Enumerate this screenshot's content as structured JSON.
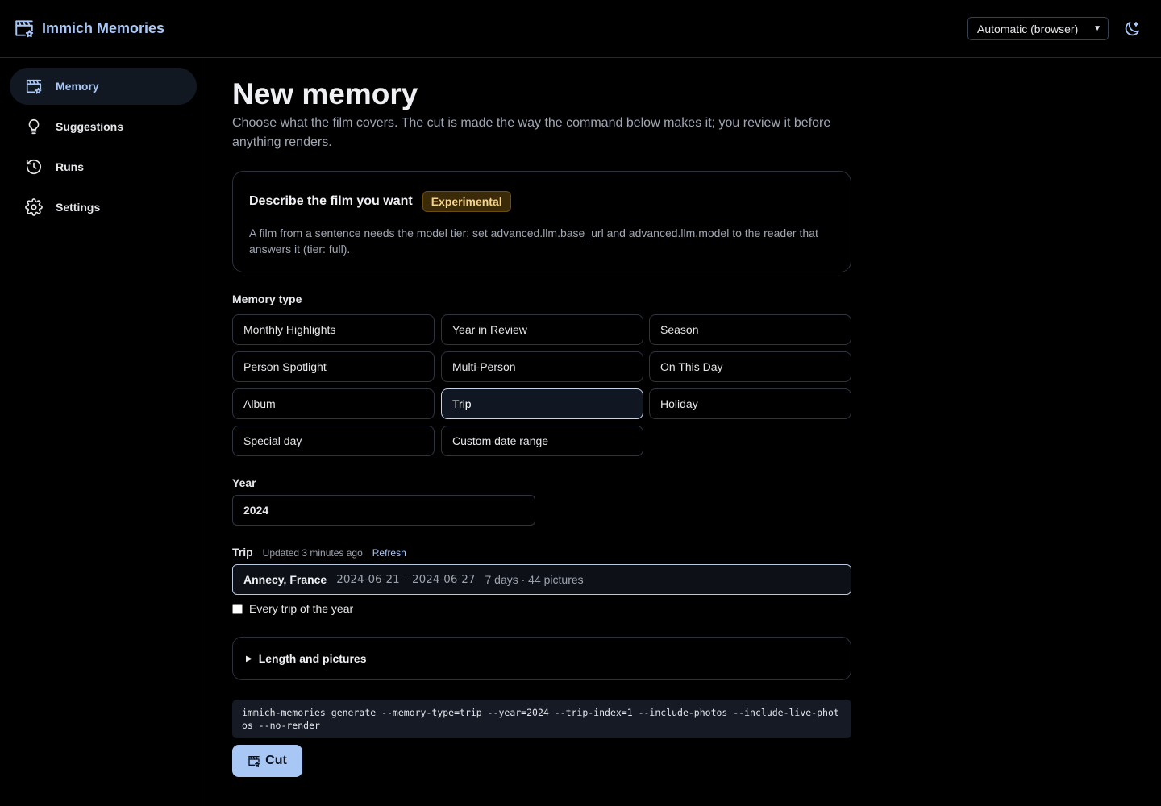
{
  "app": {
    "title": "Immich Memories"
  },
  "header": {
    "theme_select_value": "Automatic (browser)",
    "theme_options": [
      "Automatic (browser)"
    ]
  },
  "sidebar": {
    "items": [
      {
        "label": "Memory",
        "icon": "clapperboard-icon",
        "active": true
      },
      {
        "label": "Suggestions",
        "icon": "lightbulb-icon",
        "active": false
      },
      {
        "label": "Runs",
        "icon": "history-icon",
        "active": false
      },
      {
        "label": "Settings",
        "icon": "gear-icon",
        "active": false
      }
    ]
  },
  "main": {
    "title": "New memory",
    "subtitle": "Choose what the film covers. The cut is made the way the command below makes it; you review it before anything renders.",
    "describe_card": {
      "title": "Describe the film you want",
      "badge": "Experimental",
      "text": "A film from a sentence needs the model tier: set advanced.llm.base_url and advanced.llm.model to the reader that answers it (tier: full)."
    },
    "memory_type": {
      "label": "Memory type",
      "options": [
        "Monthly Highlights",
        "Year in Review",
        "Season",
        "Person Spotlight",
        "Multi-Person",
        "On This Day",
        "Album",
        "Trip",
        "Holiday",
        "Special day",
        "Custom date range"
      ],
      "selected": "Trip"
    },
    "year": {
      "label": "Year",
      "value": "2024"
    },
    "trip": {
      "label": "Trip",
      "updated": "Updated 3 minutes ago",
      "refresh": "Refresh",
      "selected_name": "Annecy, France",
      "selected_dates": "2024-06-21 – 2024-06-27",
      "selected_meta": "7 days · 44 pictures"
    },
    "every_trip_label": "Every trip of the year",
    "every_trip_checked": false,
    "details_label": "Length and pictures",
    "command": "immich-memories generate --memory-type=trip --year=2024 --trip-index=1 --include-photos --include-live-photos --no-render",
    "cut_label": "Cut"
  },
  "colors": {
    "accent": "#a9c7f5",
    "badge_bg": "#3a2a07",
    "badge_text": "#f6d38a"
  }
}
